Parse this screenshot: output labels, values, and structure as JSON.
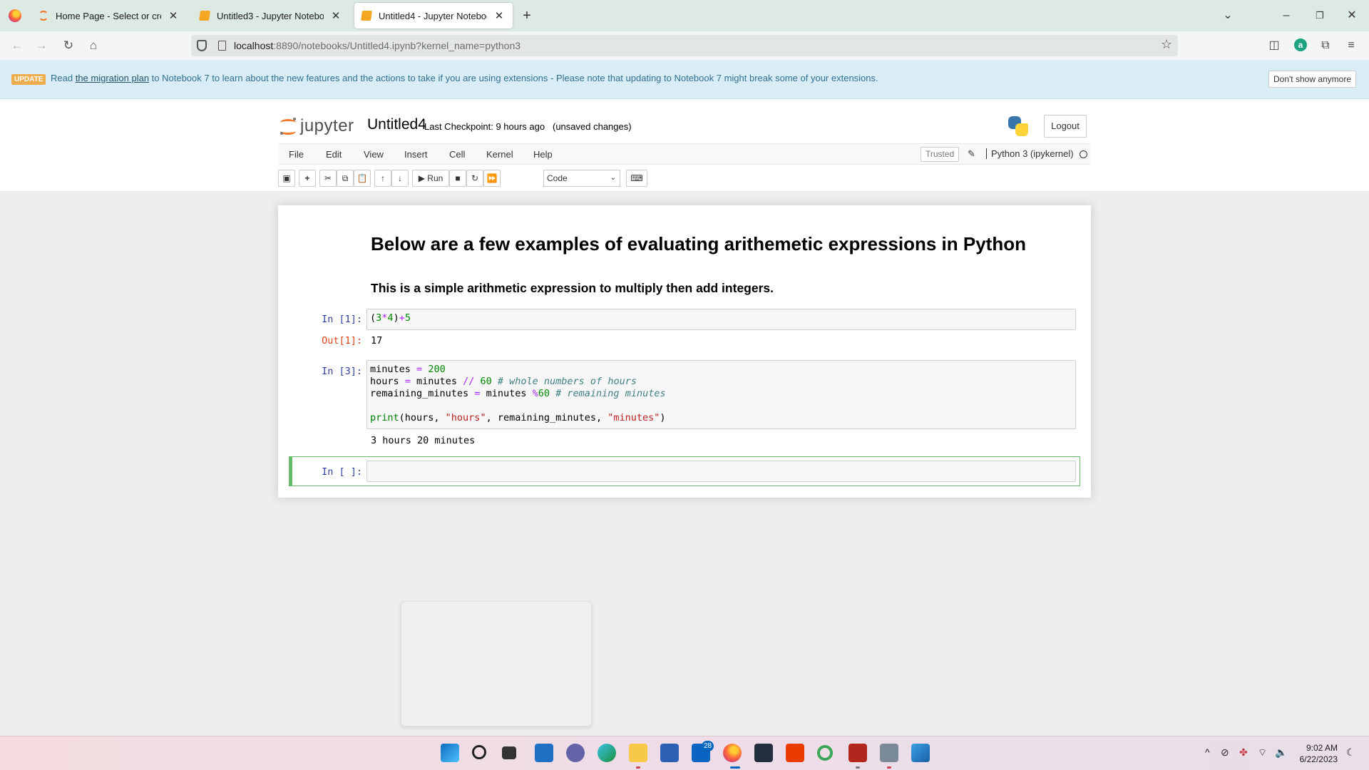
{
  "browser": {
    "tabs": [
      {
        "title": "Home Page - Select or create a",
        "icon": "jupyter-icon",
        "active": false
      },
      {
        "title": "Untitled3 - Jupyter Notebook",
        "icon": "notebook-icon",
        "active": false
      },
      {
        "title": "Untitled4 - Jupyter Notebook",
        "icon": "notebook-icon",
        "active": true
      }
    ],
    "new_tab_symbol": "+",
    "url_host": "localhost",
    "url_rest": ":8890/notebooks/Untitled4.ipynb?kernel_name=python3",
    "avatar_letter": "a"
  },
  "banner": {
    "badge": "UPDATE",
    "text_before": "Read ",
    "link_text": "the migration plan",
    "text_after": " to Notebook 7 to learn about the new features and the actions to take if you are using extensions - Please note that updating to Notebook 7 might break some of your extensions.",
    "dismiss_label": "Don't show anymore"
  },
  "header": {
    "logo_text": "jupyter",
    "notebook_name": "Untitled4",
    "checkpoint_text": "Last Checkpoint: 9 hours ago",
    "unsaved_text": "(unsaved changes)",
    "logout_label": "Logout"
  },
  "menu": {
    "items": [
      "File",
      "Edit",
      "View",
      "Insert",
      "Cell",
      "Kernel",
      "Help"
    ],
    "trusted_label": "Trusted",
    "kernel_label": "Python 3 (ipykernel)"
  },
  "toolbar": {
    "run_label": "Run",
    "cell_type": "Code"
  },
  "cells": {
    "md_heading": "Below are a few examples of evaluating arithemetic expressions in Python",
    "md_subheading": "This is a simple arithmetic expression to multiply then add integers.",
    "cell1": {
      "prompt": "In [1]:",
      "out_prompt": "Out[1]:",
      "output": "17"
    },
    "cell2": {
      "prompt": "In [3]:",
      "output": "3 hours 20 minutes"
    },
    "cell3": {
      "prompt": "In [ ]:"
    }
  },
  "taskbar": {
    "mail_badge": "28",
    "time": "9:02 AM",
    "date": "6/22/2023"
  }
}
